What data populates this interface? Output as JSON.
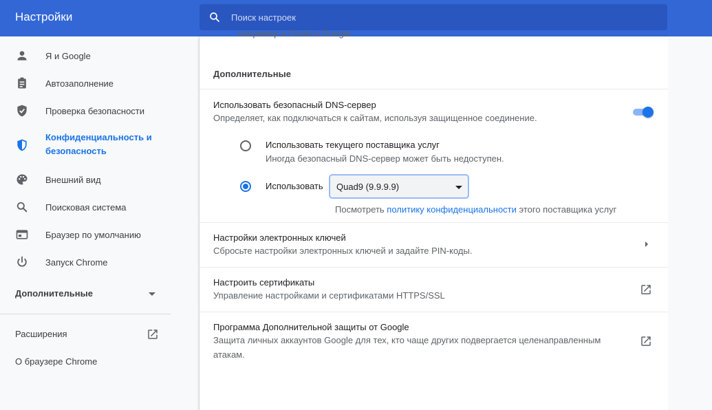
{
  "header": {
    "title": "Настройки",
    "search_placeholder": "Поиск настроек"
  },
  "sidebar": {
    "items": [
      {
        "label": "Я и Google",
        "icon": "person-icon"
      },
      {
        "label": "Автозаполнение",
        "icon": "clipboard-icon"
      },
      {
        "label": "Проверка безопасности",
        "icon": "shield-check-icon"
      },
      {
        "label": "Конфиденциальность и безопасность",
        "icon": "shield-icon"
      },
      {
        "label": "Внешний вид",
        "icon": "palette-icon"
      },
      {
        "label": "Поисковая система",
        "icon": "search-icon"
      },
      {
        "label": "Браузер по умолчанию",
        "icon": "browser-icon"
      },
      {
        "label": "Запуск Chrome",
        "icon": "power-icon"
      }
    ],
    "advanced_label": "Дополнительные",
    "extensions_label": "Расширения",
    "about_label": "О браузере Chrome"
  },
  "main": {
    "cut_text": "например в Gmail и Google",
    "section_title": "Дополнительные",
    "dns": {
      "title": "Использовать безопасный DNS-сервер",
      "subtitle": "Определяет, как подключаться к сайтам, используя защищенное соединение.",
      "toggle_on": true,
      "option_current_title": "Использовать текущего поставщика услуг",
      "option_current_sub": "Иногда безопасный DNS-сервер может быть недоступен.",
      "option_custom_label": "Использовать",
      "selected_provider": "Quad9 (9.9.9.9)",
      "policy_prefix": "Посмотреть ",
      "policy_link": "политику конфиденциальности",
      "policy_suffix": " этого поставщика услуг"
    },
    "security_keys": {
      "title": "Настройки электронных ключей",
      "subtitle": "Сбросьте настройки электронных ключей и задайте PIN-коды."
    },
    "certificates": {
      "title": "Настроить сертификаты",
      "subtitle": "Управление настройками и сертификатами HTTPS/SSL"
    },
    "advanced_protection": {
      "title": "Программа Дополнительной защиты от Google",
      "subtitle_line1": "Защита личных аккаунтов Google для тех, кто чаще других подвергается целенаправленным",
      "subtitle_line2": "атакам."
    }
  },
  "colors": {
    "accent": "#1a73e8",
    "header": "#3367d6"
  }
}
